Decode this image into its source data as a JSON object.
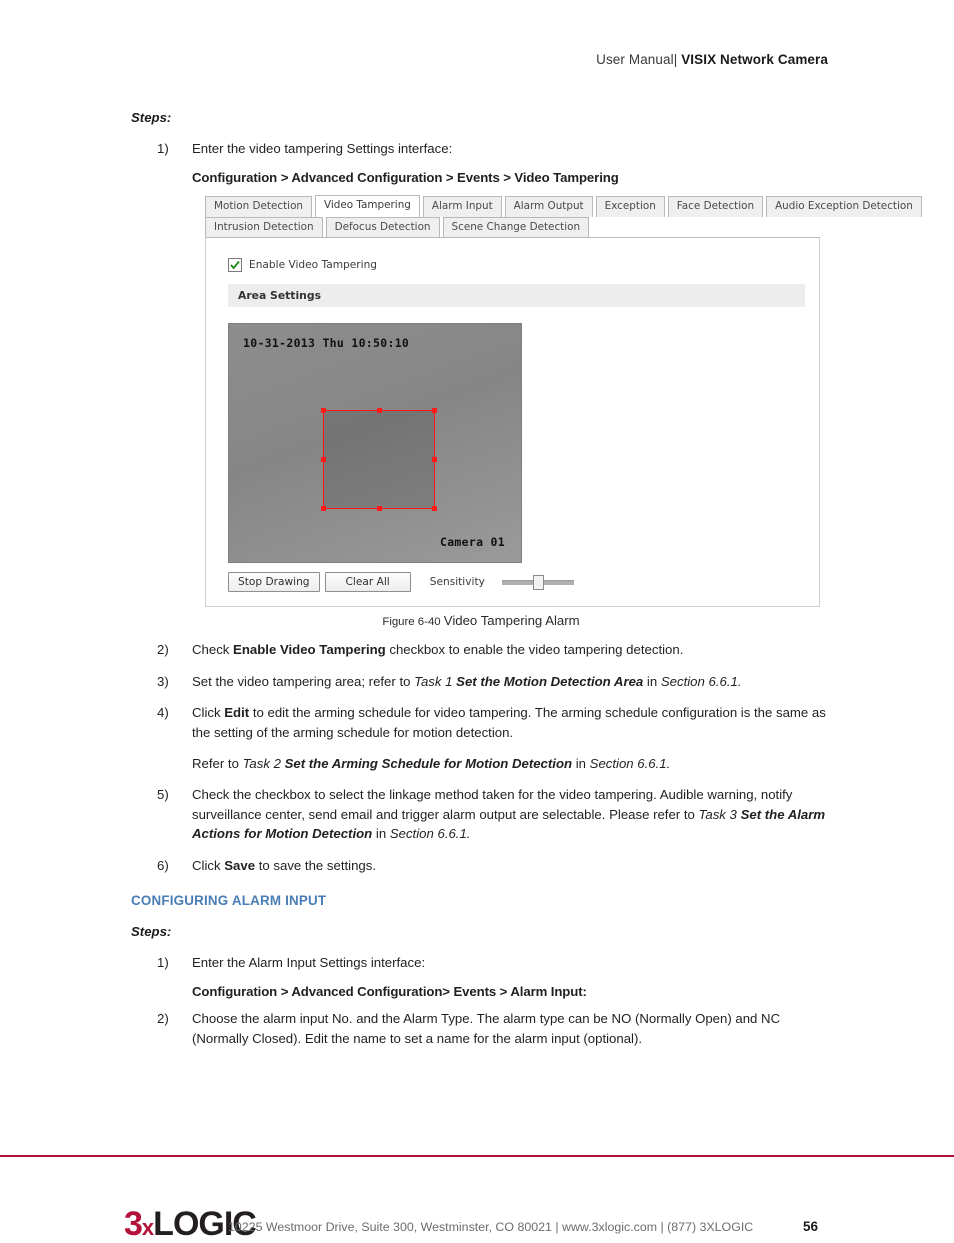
{
  "header": {
    "prefix": "User Manual| ",
    "title": "VISIX Network Camera"
  },
  "section1": {
    "steps_label": "Steps:",
    "step1_num": "1)",
    "step1_text": "Enter the video tampering Settings interface:",
    "step1_path": "Configuration > Advanced Configuration > Events > Video Tampering",
    "step2_num": "2)",
    "step2_a": "Check ",
    "step2_b": "Enable Video Tampering",
    "step2_c": " checkbox to enable the video tampering detection.",
    "step3_num": "3)",
    "step3_a": "Set the video tampering area; refer to ",
    "step3_i1": "Task 1 ",
    "step3_bi": "Set the Motion Detection Area",
    "step3_mid": " in ",
    "step3_i2": "Section 6.6.1.",
    "step4_num": "4)",
    "step4_a": "Click ",
    "step4_b": "Edit",
    "step4_c": " to edit the arming schedule for video tampering. The arming schedule configuration is the same as the setting of the arming schedule for motion detection.",
    "refer_a": "Refer to ",
    "refer_i1": "Task 2 ",
    "refer_bi": "Set the Arming Schedule for Motion Detection",
    "refer_mid": " in ",
    "refer_i2": "Section 6.6.1.",
    "step5_num": "5)",
    "step5_a": "Check the checkbox to select the linkage method taken for the video tampering. Audible warning, notify surveillance center, send email and trigger alarm output are selectable. Please refer to ",
    "step5_i1": "Task 3 ",
    "step5_bi": "Set the Alarm Actions for Motion Detection",
    "step5_mid": " in ",
    "step5_i2": "Section 6.6.1.",
    "step6_num": "6)",
    "step6_a": "Click ",
    "step6_b": "Save",
    "step6_c": " to save the settings."
  },
  "figure": {
    "caption_num": "Figure 6-40 ",
    "caption_text": "Video Tampering Alarm",
    "tabs_row1": [
      "Motion Detection",
      "Video Tampering",
      "Alarm Input",
      "Alarm Output",
      "Exception",
      "Face Detection",
      "Audio Exception Detection"
    ],
    "active_tab": "Video Tampering",
    "tabs_row2": [
      "Intrusion Detection",
      "Defocus Detection",
      "Scene Change Detection"
    ],
    "enable_checkbox_label": "Enable Video Tampering",
    "enable_checkbox_checked": true,
    "area_settings_label": "Area Settings",
    "osd_timestamp": "10-31-2013 Thu 10:50:10",
    "osd_camera": "Camera 01",
    "btn_stop_drawing": "Stop Drawing",
    "btn_clear_all": "Clear All",
    "sensitivity_label": "Sensitivity",
    "sensitivity_value": 43,
    "colors": {
      "draw_rect": "#ff1a1a",
      "area_bar": "#ededed",
      "video_bg": "#8d8d8d"
    }
  },
  "section2": {
    "heading": "CONFIGURING ALARM INPUT",
    "steps_label": "Steps:",
    "step1_num": "1)",
    "step1_text": "Enter the Alarm Input Settings interface:",
    "step1_path": "Configuration > Advanced Configuration> Events > Alarm Input:",
    "step2_num": "2)",
    "step2_text": "Choose the alarm input No. and the Alarm Type. The alarm type can be NO (Normally Open) and NC (Normally Closed). Edit the name to set a name for the alarm input (optional)."
  },
  "footer": {
    "logo_3": "3",
    "logo_x": "x",
    "logo_logic": "LOGIC",
    "address": "10225 Westmoor Drive, Suite 300, Westminster, CO 80021 | www.3xlogic.com | (877) 3XLOGIC",
    "page_number": "56",
    "rule_color": "#b3123a"
  }
}
